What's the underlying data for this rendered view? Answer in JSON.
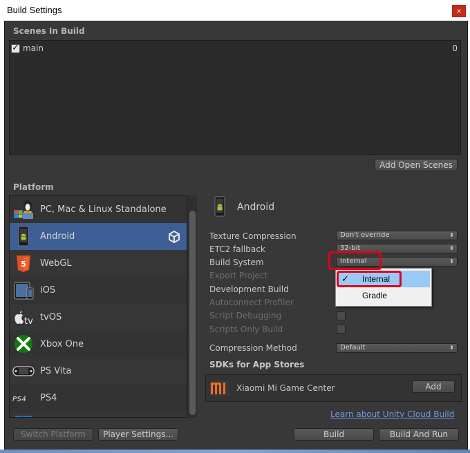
{
  "window": {
    "title": "Build Settings",
    "close_glyph": "×"
  },
  "scenes": {
    "header": "Scenes In Build",
    "items": [
      {
        "name": "main",
        "index": "0",
        "checked": true
      }
    ],
    "add_button": "Add Open Scenes"
  },
  "platform": {
    "header": "Platform",
    "items": [
      {
        "label": "PC, Mac & Linux Standalone",
        "icon": "pc-mac-linux-icon"
      },
      {
        "label": "Android",
        "icon": "android-icon",
        "selected": true
      },
      {
        "label": "WebGL",
        "icon": "html5-icon"
      },
      {
        "label": "iOS",
        "icon": "ios-device-icon"
      },
      {
        "label": "tvOS",
        "icon": "apple-tv-icon"
      },
      {
        "label": "Xbox One",
        "icon": "xbox-icon"
      },
      {
        "label": "PS Vita",
        "icon": "ps-vita-icon"
      },
      {
        "label": "PS4",
        "icon": "ps4-icon"
      }
    ]
  },
  "settings": {
    "platform_title": "Android",
    "texture_compression": {
      "label": "Texture Compression",
      "value": "Don't override"
    },
    "etc2_fallback": {
      "label": "ETC2 fallback",
      "value": "32-bit"
    },
    "build_system": {
      "label": "Build System",
      "value": "Internal"
    },
    "export_project": {
      "label": "Export Project"
    },
    "development_build": {
      "label": "Development Build"
    },
    "autoconnect_profiler": {
      "label": "Autoconnect Profiler"
    },
    "script_debugging": {
      "label": "Script Debugging"
    },
    "scripts_only_build": {
      "label": "Scripts Only Build"
    },
    "compression_method": {
      "label": "Compression Method",
      "value": "Default"
    },
    "sdks_header": "SDKs for App Stores",
    "sdk": {
      "name": "Xiaomi Mi Game Center",
      "logo": "mi",
      "add_label": "Add"
    },
    "cloud_link": "Learn about Unity Cloud Build"
  },
  "build_system_menu": {
    "options": [
      {
        "label": "Internal",
        "checked": true,
        "check_glyph": "✓"
      },
      {
        "label": "Gradle",
        "checked": false
      }
    ]
  },
  "footer": {
    "switch_platform": "Switch Platform",
    "player_settings": "Player Settings...",
    "build": "Build",
    "build_and_run": "Build And Run"
  },
  "colors": {
    "window_bg": "#383838",
    "selected_row": "#3e5f96",
    "highlight_annotation": "#e0001b",
    "link": "#6f9ce8",
    "mi_orange": "#f26d21"
  }
}
